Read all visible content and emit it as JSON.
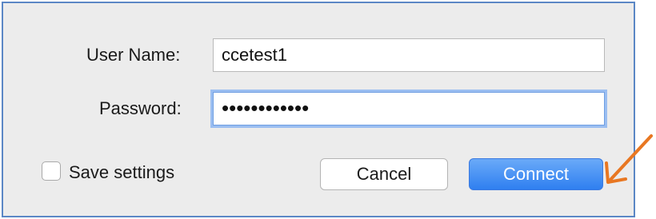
{
  "login_form": {
    "username_label": "User Name:",
    "username_value": "ccetest1",
    "password_label": "Password:",
    "password_masked": "••••••••••••",
    "save_settings_label": "Save settings",
    "save_settings_checked": false,
    "cancel_label": "Cancel",
    "connect_label": "Connect"
  },
  "colors": {
    "frame_border": "#5b87c5",
    "connect_button": "#3d8bf5",
    "arrow": "#e87722"
  }
}
